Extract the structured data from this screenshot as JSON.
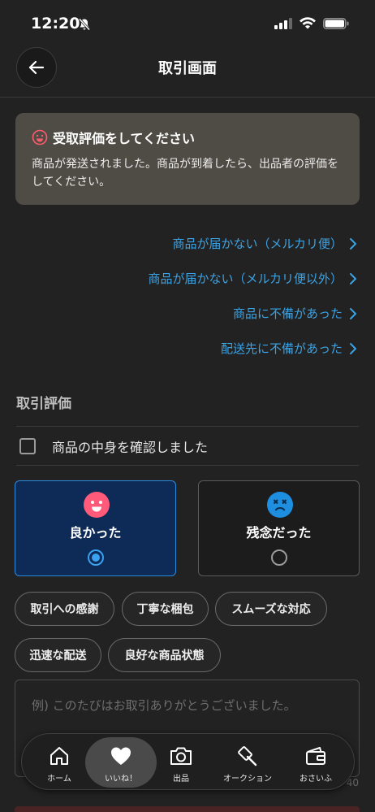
{
  "status_bar": {
    "time": "12:20"
  },
  "header": {
    "title": "取引画面"
  },
  "notice": {
    "title": "受取評価をしてください",
    "body": "商品が発送されました。商品が到着したら、出品者の評価をしてください。"
  },
  "links": [
    "商品が届かない（メルカリ便）",
    "商品が届かない（メルカリ便以外）",
    "商品に不備があった",
    "配送先に不備があった"
  ],
  "section": {
    "title": "取引評価",
    "checkbox_label": "商品の中身を確認しました"
  },
  "rating": {
    "good_label": "良かった",
    "bad_label": "残念だった",
    "selected": "good"
  },
  "tags": [
    "取引への感謝",
    "丁寧な梱包",
    "スムーズな対応",
    "迅速な配送",
    "良好な商品状態"
  ],
  "comment": {
    "placeholder": "例) このたびはお取引ありがとうございました。",
    "count": "40"
  },
  "nav": {
    "items": [
      "ホーム",
      "いいね！",
      "出品",
      "オークション",
      "おさいふ"
    ],
    "active": "いいね！"
  },
  "colors": {
    "link": "#3aa3e6",
    "good_bg": "#0e2a56",
    "good_border": "#2d8bdc",
    "good_face": "#ff5a7a",
    "bad_face": "#1e8fe0",
    "notice_bg": "#4f4c45"
  }
}
